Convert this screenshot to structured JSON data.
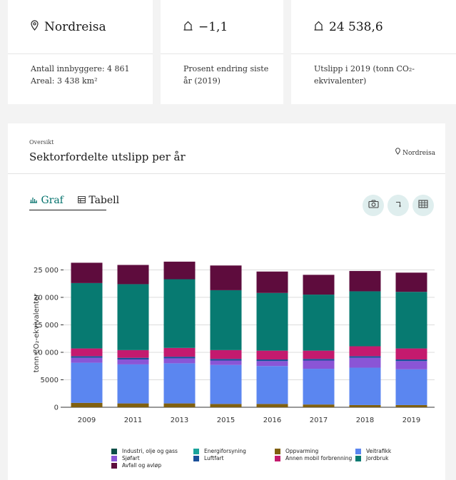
{
  "stats": [
    {
      "icon": "location-pin-icon",
      "head": "Nordreisa",
      "lines": [
        "Antall innbyggere: 4 861",
        "Areal: 3 438 km²"
      ]
    },
    {
      "icon": "house-icon",
      "head": "−1,1",
      "lines": [
        "Prosent endring siste år (2019)"
      ]
    },
    {
      "icon": "house-icon",
      "head": "24 538,6",
      "lines": [
        "Utslipp i 2019 (tonn CO₂-",
        "ekvivalenter)"
      ]
    }
  ],
  "section": {
    "overline": "Oversikt",
    "title": "Sektorfordelte utslipp per år",
    "location": "Nordreisa"
  },
  "tabs": [
    {
      "label": "Graf",
      "icon": "bar-chart-icon",
      "active": true
    },
    {
      "label": "Tabell",
      "icon": "table-icon",
      "active": false
    }
  ],
  "actions": [
    {
      "name": "screenshot-button",
      "icon": "camera-icon"
    },
    {
      "name": "download-button",
      "icon": "arrow-icon"
    },
    {
      "name": "table-view-button",
      "icon": "grid-icon"
    }
  ],
  "chart_data": {
    "type": "bar",
    "stacked": true,
    "categories": [
      "2009",
      "2011",
      "2013",
      "2015",
      "2016",
      "2017",
      "2018",
      "2019"
    ],
    "ylabel": "tonn CO₂-ekvivalenter",
    "ylim": [
      0,
      27000
    ],
    "yticks": [
      "0",
      "5000",
      "10 000",
      "15 000",
      "20 000",
      "25 000"
    ],
    "ytick_values": [
      0,
      5000,
      10000,
      15000,
      20000,
      25000
    ],
    "grid": true,
    "legend_position": "bottom",
    "series": [
      {
        "name": "Industri, olje og gass",
        "color": "#0b4f47",
        "values": [
          0,
          0,
          0,
          0,
          0,
          0,
          0,
          0
        ]
      },
      {
        "name": "Energiforsyning",
        "color": "#1aa39b",
        "values": [
          0,
          0,
          0,
          0,
          0,
          0,
          0,
          0
        ]
      },
      {
        "name": "Oppvarming",
        "color": "#806010",
        "values": [
          800,
          700,
          700,
          600,
          600,
          500,
          400,
          400
        ]
      },
      {
        "name": "Veitrafikk",
        "color": "#5b86f0",
        "values": [
          7300,
          7100,
          7300,
          7100,
          6900,
          6500,
          6800,
          6500
        ]
      },
      {
        "name": "Sjøfart",
        "color": "#8a55d6",
        "values": [
          900,
          900,
          900,
          800,
          900,
          1500,
          1800,
          1500
        ]
      },
      {
        "name": "Luftfart",
        "color": "#1a4f99",
        "values": [
          300,
          300,
          300,
          300,
          300,
          300,
          300,
          300
        ]
      },
      {
        "name": "Annen mobil forbrenning",
        "color": "#c41a6e",
        "values": [
          1400,
          1400,
          1600,
          1600,
          1600,
          1500,
          1800,
          2000
        ]
      },
      {
        "name": "Jordbruk",
        "color": "#077a71",
        "values": [
          11900,
          12000,
          12500,
          10900,
          10500,
          10200,
          10000,
          10300
        ]
      },
      {
        "name": "Avfall og avløp",
        "color": "#5e0c3d",
        "values": [
          3700,
          3500,
          3200,
          4500,
          3900,
          3600,
          3700,
          3500
        ]
      }
    ]
  }
}
